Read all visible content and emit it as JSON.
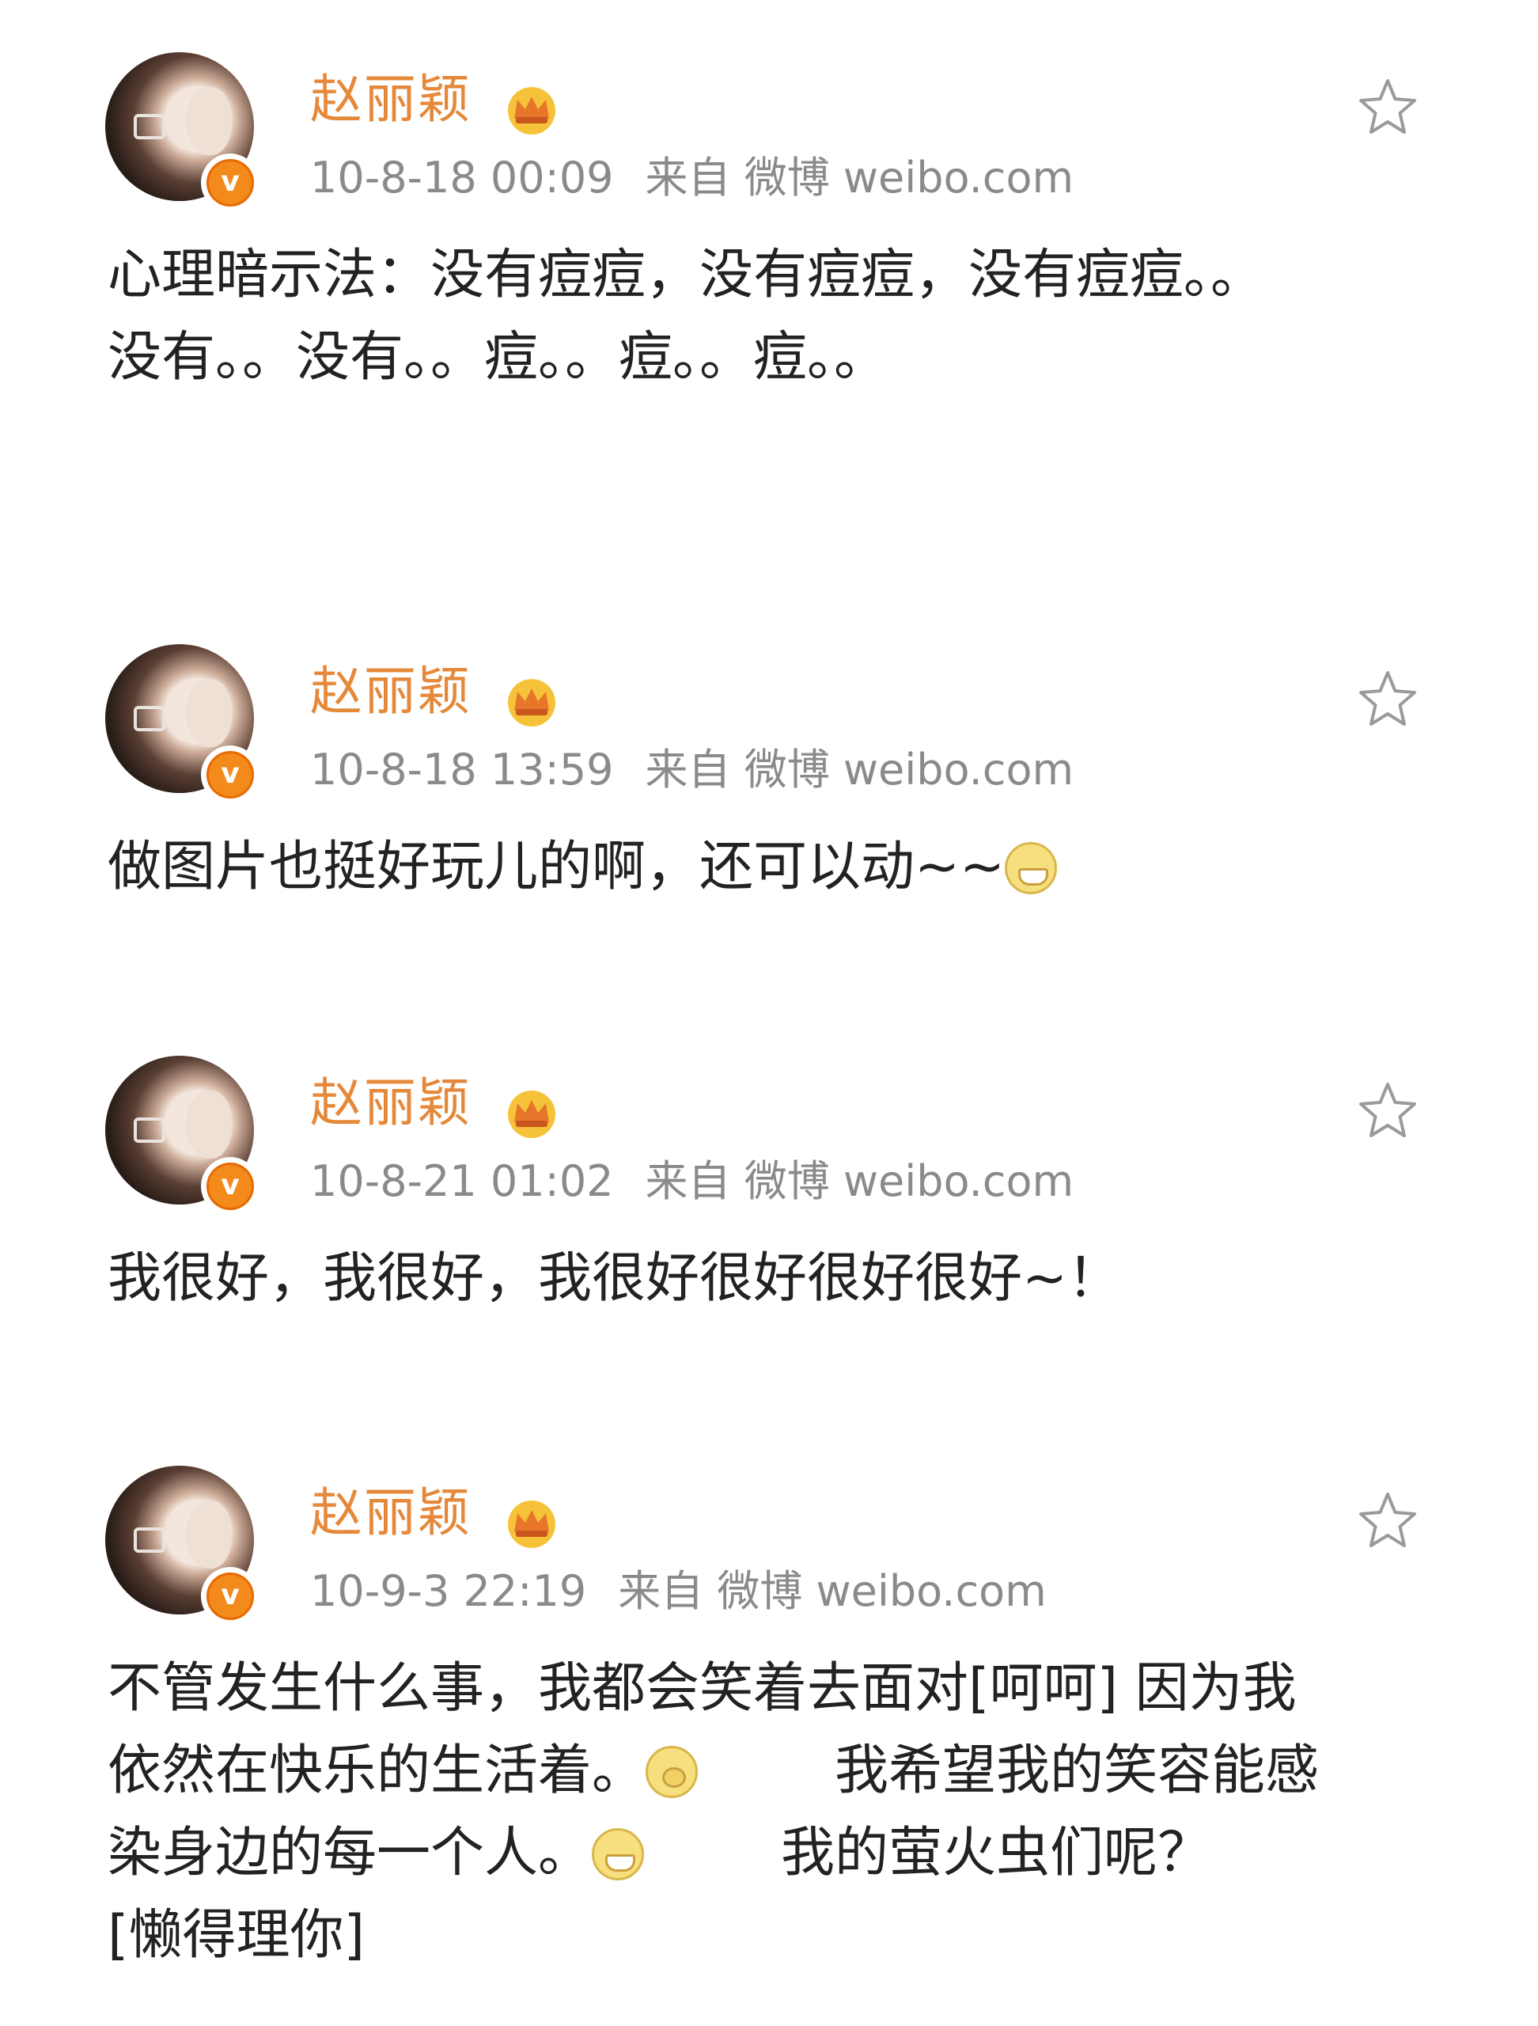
{
  "posts": [
    {
      "name": "赵丽颖",
      "time": "10-8-18 00:09",
      "source": "来自 微博 weibo.com",
      "text": "心理暗示法：没有痘痘，没有痘痘，没有痘痘。。\n没有。。没有。。痘。。痘。。痘。。"
    },
    {
      "name": "赵丽颖",
      "time": "10-8-18 13:59",
      "source": "来自 微博 weibo.com",
      "text": "做图片也挺好玩儿的啊，还可以动~~",
      "emoji": "grin-emoji"
    },
    {
      "name": "赵丽颖",
      "time": "10-8-21 01:02",
      "source": "来自 微博 weibo.com",
      "text": "我很好，我很好，我很好很好很好很好~！"
    },
    {
      "name": "赵丽颖",
      "time": "10-9-3 22:19",
      "source": "来自 微博 weibo.com",
      "text_a": "不管发生什么事，我都会笑着去面对[呵呵] 因为我\n依然在快乐的生活着。",
      "text_b": "        我希望我的笑容能感\n染身边的每一个人。",
      "text_c": "        我的萤火虫们呢？\n[懒得理你]",
      "emojis": [
        "think-emoji",
        "grin-emoji"
      ]
    }
  ],
  "colors": {
    "name": "#e5883a",
    "meta": "#8a8a8a",
    "text": "#222222",
    "verified_badge": "#f28a1c"
  },
  "icons": {
    "crown": "crown-icon",
    "verified": "verified-v-icon",
    "favorite": "star-icon"
  }
}
